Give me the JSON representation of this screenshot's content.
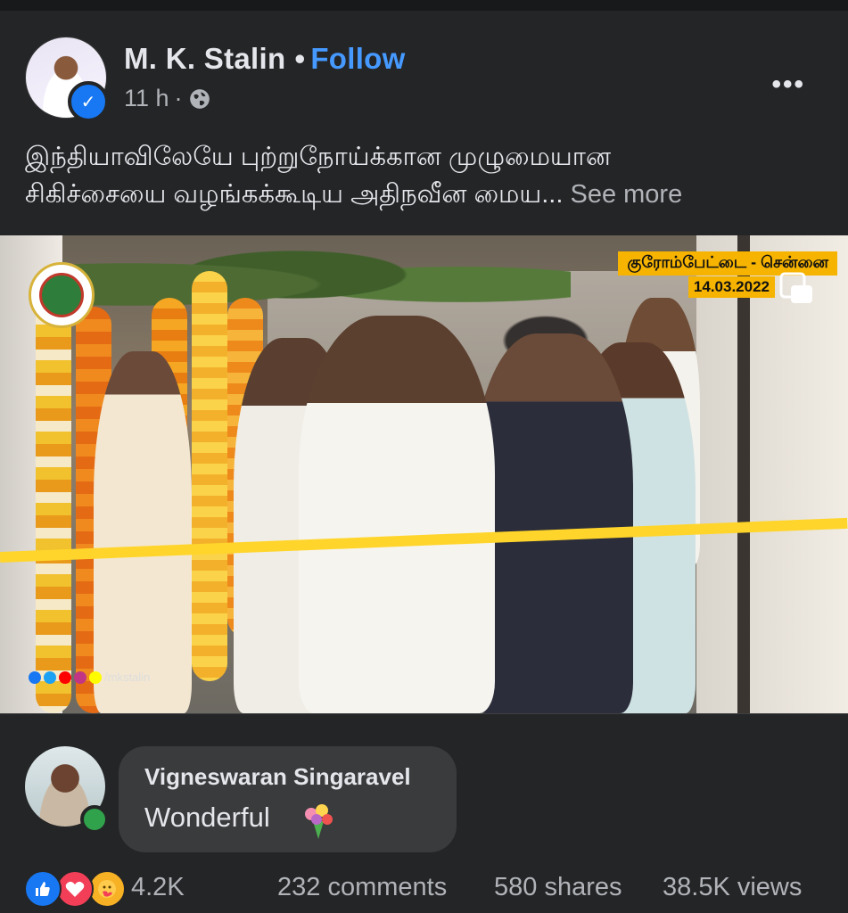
{
  "post": {
    "author": "M. K. Stalin",
    "separator": "•",
    "follow_label": "Follow",
    "time": "11 h",
    "meta_separator": "·",
    "audience_icon": "globe-icon",
    "more_label": "•••",
    "caption_line1": "இந்தியாவிலேயே புற்றுநோய்க்கான முழுமையான",
    "caption_line2": "சிகிச்சையை வழங்கக்கூடிய அதிநவீன மைய...",
    "see_more_label": "See more"
  },
  "video": {
    "location_badge": "குரோம்பேட்டை - சென்னை",
    "date_badge": "14.03.2022",
    "watermark_handle": "/mkstalin",
    "icons": [
      "tn-emblem-icon",
      "pip-icon",
      "facebook-icon",
      "twitter-icon",
      "youtube-icon",
      "instagram-icon",
      "snapchat-icon"
    ]
  },
  "comment": {
    "author": "Vigneswaran Singaravel",
    "text": "Wonderful",
    "emoji_icon": "bouquet-icon",
    "online": true
  },
  "stats": {
    "reaction_icons": [
      "like-icon",
      "love-icon",
      "care-icon"
    ],
    "reaction_count": "4.2K",
    "comments": "232 comments",
    "shares": "580 shares",
    "views": "38.5K views"
  },
  "colors": {
    "background": "#242526",
    "follow": "#4599ff",
    "like": "#1877f2",
    "love": "#f33e58",
    "care": "#f7b125",
    "online": "#31a24c",
    "badge": "#f6b300"
  }
}
